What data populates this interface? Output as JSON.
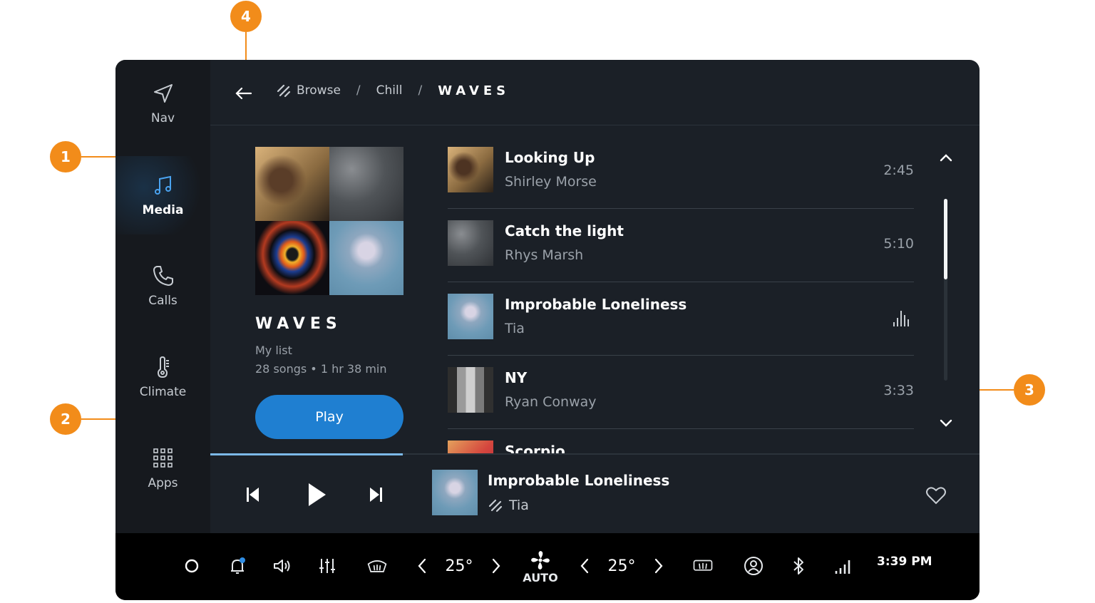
{
  "rail": {
    "items": [
      {
        "label": "Nav",
        "icon": "navigation-arrow-icon"
      },
      {
        "label": "Media",
        "icon": "music-note-icon",
        "active": true
      },
      {
        "label": "Calls",
        "icon": "phone-icon"
      },
      {
        "label": "Climate",
        "icon": "thermometer-icon"
      },
      {
        "label": "Apps",
        "icon": "apps-grid-icon"
      }
    ]
  },
  "header": {
    "breadcrumb": [
      "Browse",
      "Chill",
      "WAVES"
    ],
    "separator": "/"
  },
  "album": {
    "title": "WAVES",
    "subtitle": "My list",
    "meta": "28 songs • 1 hr 38 min",
    "play_label": "Play"
  },
  "tracks": [
    {
      "title": "Looking Up",
      "artist": "Shirley Morse",
      "duration": "2:45"
    },
    {
      "title": "Catch the light",
      "artist": "Rhys Marsh",
      "duration": "5:10"
    },
    {
      "title": "Improbable Loneliness",
      "artist": "Tia",
      "duration": "",
      "playing": true
    },
    {
      "title": "NY",
      "artist": "Ryan Conway",
      "duration": "3:33"
    },
    {
      "title": "Scorpio",
      "artist": "",
      "duration": ""
    }
  ],
  "now_playing": {
    "title": "Improbable Loneliness",
    "artist": "Tia",
    "progress": 0.25
  },
  "system_bar": {
    "left_temp": "25°",
    "right_temp": "25°",
    "fan_mode": "AUTO",
    "clock": "3:39 PM"
  },
  "callouts": [
    "1",
    "2",
    "3",
    "4"
  ],
  "colors": {
    "accent": "#1f7fd1",
    "callout": "#f28c1a",
    "background": "#1b2027",
    "rail": "#16191e",
    "system_bar": "#000000",
    "notification_dot": "#2f8de4"
  }
}
